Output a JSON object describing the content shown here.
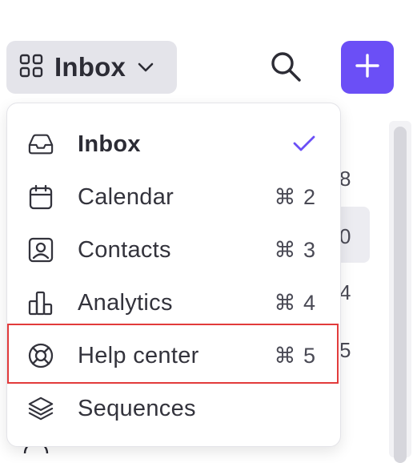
{
  "header": {
    "workspace_title": "Inbox",
    "workspace_icon": "apps-grid-icon",
    "search_icon": "search-icon",
    "add_icon": "plus-icon",
    "accent_color": "#6b4ff6"
  },
  "background_list": {
    "counts": [
      "8",
      "0",
      "4",
      "5"
    ]
  },
  "menu": {
    "items": [
      {
        "label": "Inbox",
        "icon": "inbox-tray-icon",
        "shortcut": "",
        "selected": true
      },
      {
        "label": "Calendar",
        "icon": "calendar-icon",
        "shortcut": "⌘ 2",
        "selected": false
      },
      {
        "label": "Contacts",
        "icon": "contact-card-icon",
        "shortcut": "⌘ 3",
        "selected": false
      },
      {
        "label": "Analytics",
        "icon": "bar-chart-icon",
        "shortcut": "⌘ 4",
        "selected": false
      },
      {
        "label": "Help center",
        "icon": "lifebuoy-icon",
        "shortcut": "⌘ 5",
        "selected": false
      },
      {
        "label": "Sequences",
        "icon": "layers-icon",
        "shortcut": "",
        "selected": false
      }
    ],
    "highlighted_item": "Help center",
    "highlight_color": "#e23b3b"
  }
}
